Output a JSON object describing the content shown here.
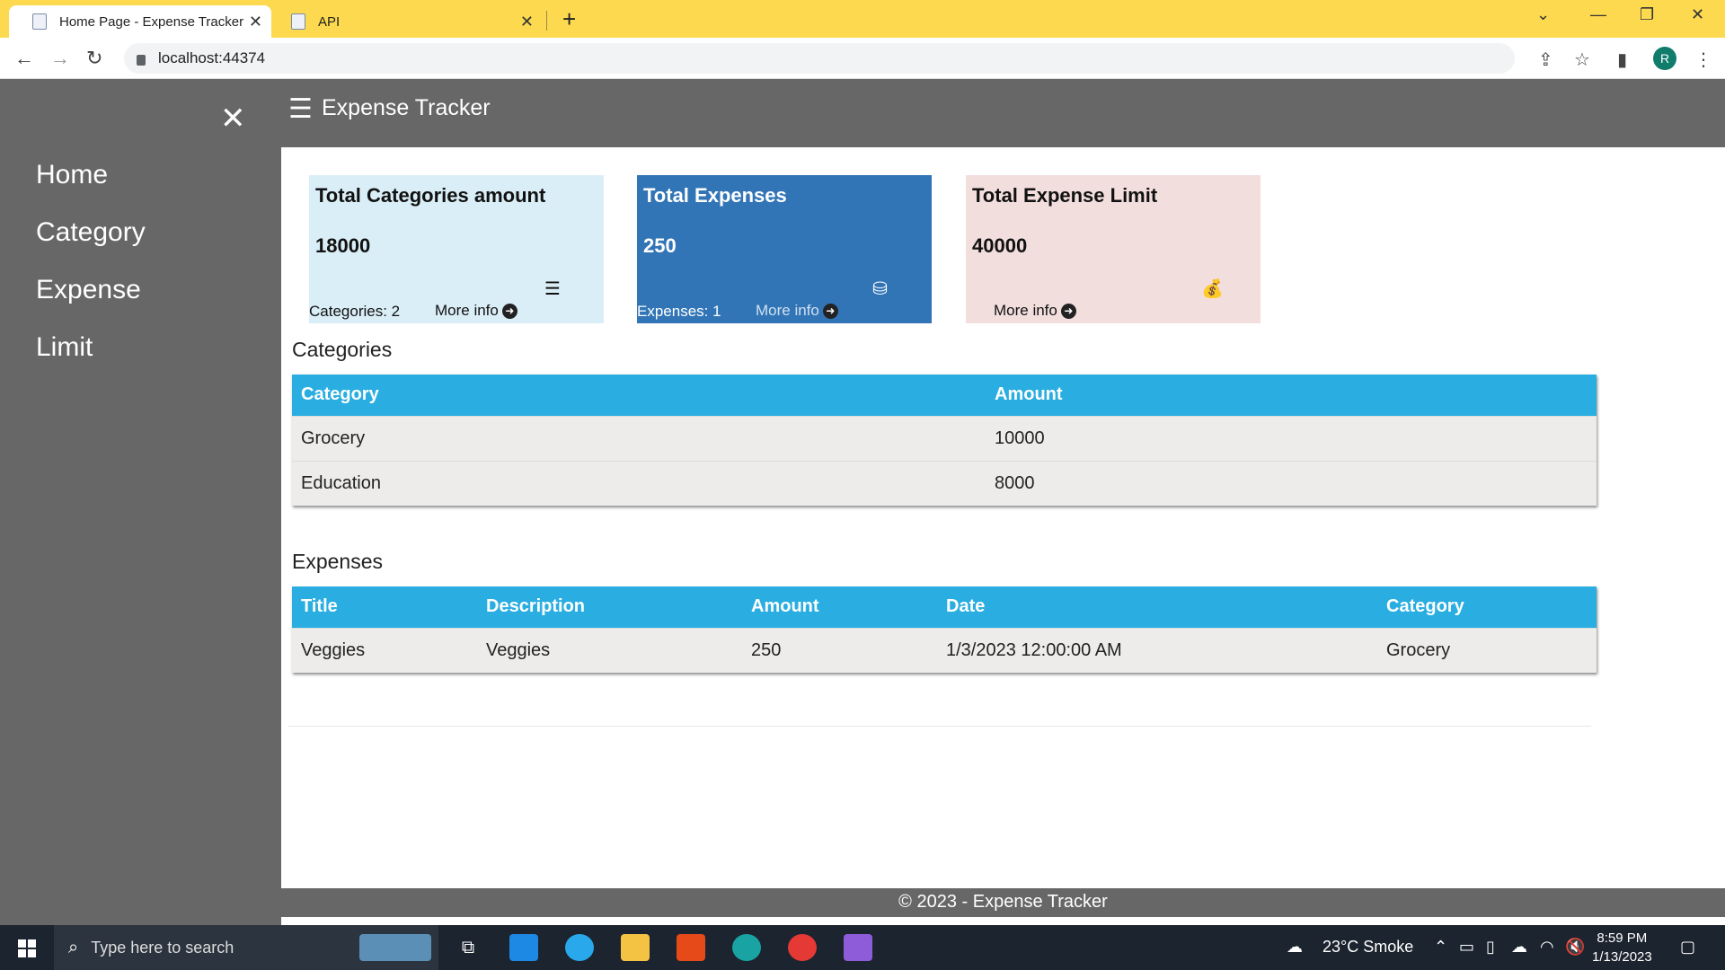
{
  "browser": {
    "tabs": [
      {
        "label": "Home Page - Expense Tracker",
        "active": true
      },
      {
        "label": "API",
        "active": false
      }
    ],
    "url": "localhost:44374",
    "profile_initial": "R"
  },
  "app": {
    "title": "Expense Tracker",
    "nav": [
      {
        "label": "Home"
      },
      {
        "label": "Category"
      },
      {
        "label": "Expense"
      },
      {
        "label": "Limit"
      }
    ],
    "cards": [
      {
        "title": "Total Categories amount",
        "value": "18000",
        "footer": "Categories: 2",
        "more": "More info",
        "icon": "list-icon",
        "bg": "#daeef7"
      },
      {
        "title": "Total Expenses",
        "value": "250",
        "footer": "Expenses: 1",
        "more": "More info",
        "icon": "coins-icon",
        "bg": "#3275b6"
      },
      {
        "title": "Total Expense Limit",
        "value": "40000",
        "footer": "",
        "more": "More info",
        "icon": "money-bag-icon",
        "bg": "#f3dede"
      }
    ],
    "categories_section": {
      "title": "Categories",
      "headers": [
        "Category",
        "Amount"
      ],
      "rows": [
        [
          "Grocery",
          "10000"
        ],
        [
          "Education",
          "8000"
        ]
      ]
    },
    "expenses_section": {
      "title": "Expenses",
      "headers": [
        "Title",
        "Description",
        "Amount",
        "Date",
        "Category"
      ],
      "rows": [
        [
          "Veggies",
          "Veggies",
          "250",
          "1/3/2023 12:00:00 AM",
          "Grocery"
        ]
      ]
    },
    "footer": "© 2023 - Expense Tracker",
    "colors": {
      "header": "#676767",
      "table_header": "#2aaee1",
      "accent_blue": "#3275b6"
    }
  },
  "taskbar": {
    "search_placeholder": "Type here to search",
    "weather": "23°C  Smoke",
    "time": "8:59 PM",
    "date": "1/13/2023"
  }
}
